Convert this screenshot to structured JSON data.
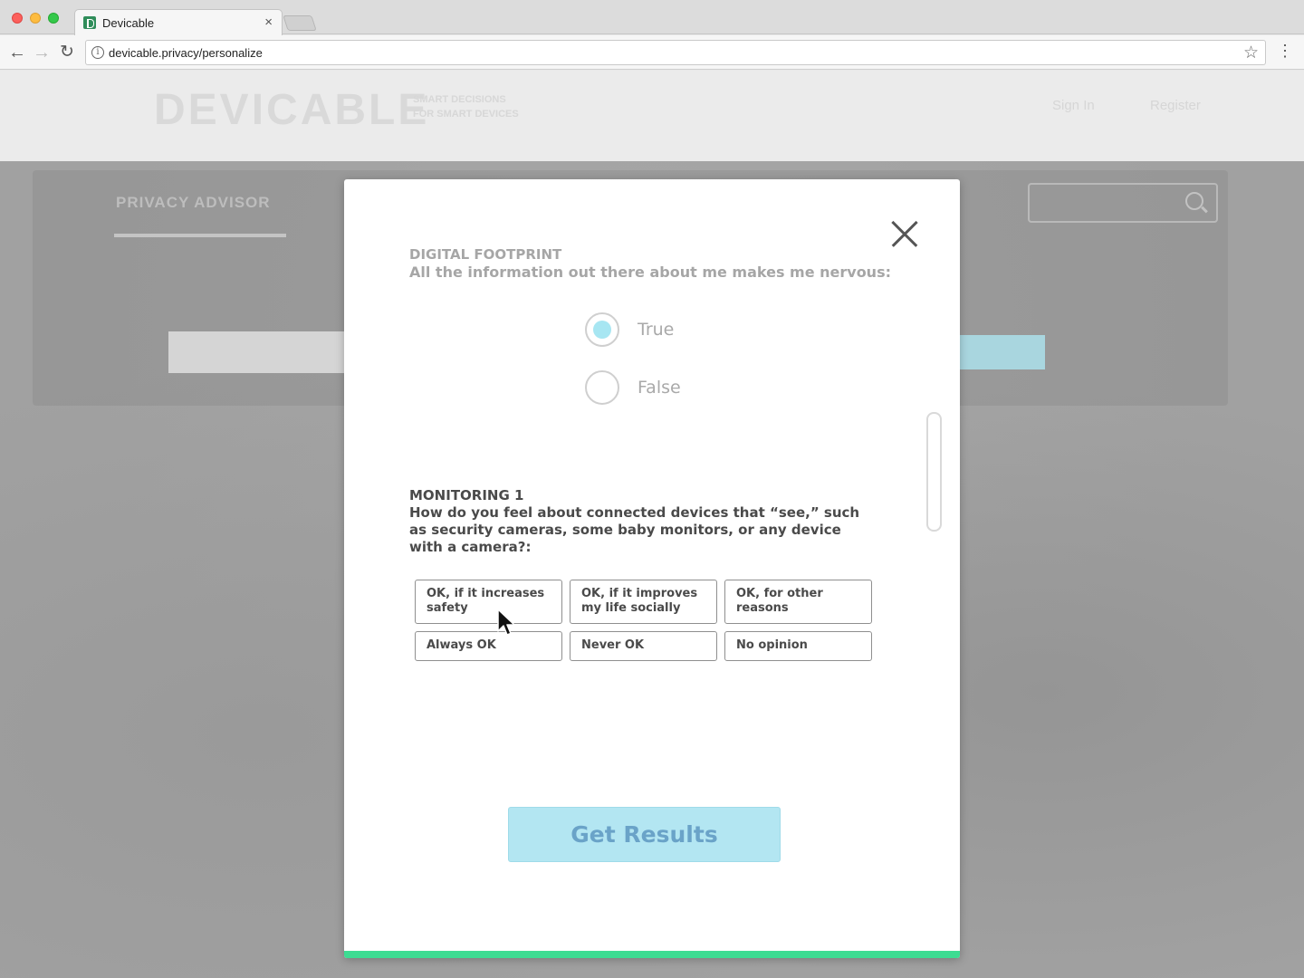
{
  "browser": {
    "tab_title": "Devicable",
    "tab_close": "×",
    "url": "devicable.privacy/personalize",
    "info_glyph": "i",
    "star_glyph": "☆",
    "menu_glyph": "⋮",
    "back_glyph": "←",
    "forward_glyph": "→",
    "reload_glyph": "↻"
  },
  "site": {
    "logo": "DEVICABLE",
    "tagline_line1": "SMART DECISIONS",
    "tagline_line2": "FOR SMART DEVICES",
    "sign_in": "Sign In",
    "register": "Register",
    "hero_title": "PRIVACY ADVISOR"
  },
  "modal": {
    "question1": {
      "category": "DIGITAL FOOTPRINT",
      "text": "All the information out there about me makes me nervous:",
      "options": [
        {
          "label": "True",
          "selected": true
        },
        {
          "label": "False",
          "selected": false
        }
      ]
    },
    "question2": {
      "category": "MONITORING 1",
      "text": "How do you feel about connected devices that “see,” such as security cameras, some baby monitors, or any device with a camera?:",
      "options": [
        "OK, if it increases safety",
        "OK, if it improves my life socially",
        "OK, for other reasons",
        "Always OK",
        "Never OK",
        "No opinion"
      ]
    },
    "submit_label": "Get Results"
  },
  "colors": {
    "accent_progress": "#3ddc92",
    "radio_selected": "#a7e6f2",
    "cta_background": "#b3e6f2",
    "cta_text": "#6aa3c8"
  }
}
